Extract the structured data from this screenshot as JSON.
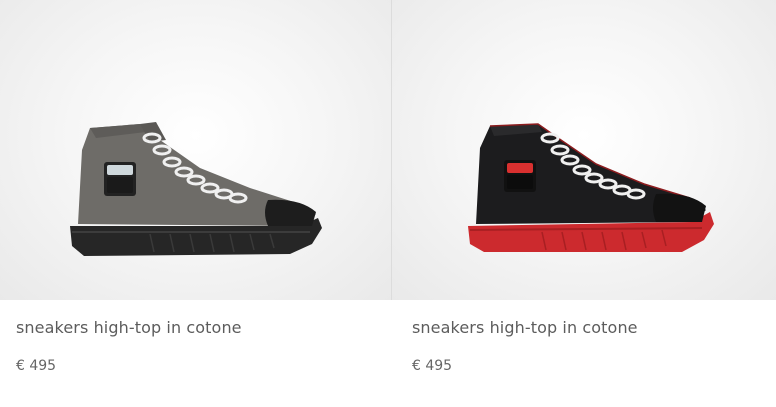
{
  "products": [
    {
      "name": "sneakers high-top in cotone",
      "price": "€ 495",
      "colors": {
        "upper": "#6e6c68",
        "sole": "#2a2a2a",
        "laces": "#f2f2f2",
        "accent": "#cfd8dc"
      }
    },
    {
      "name": "sneakers high-top in cotone",
      "price": "€ 495",
      "colors": {
        "upper": "#1c1c1e",
        "sole": "#cf2a2e",
        "laces": "#f2f2f2",
        "accent": "#d8302f"
      }
    }
  ]
}
